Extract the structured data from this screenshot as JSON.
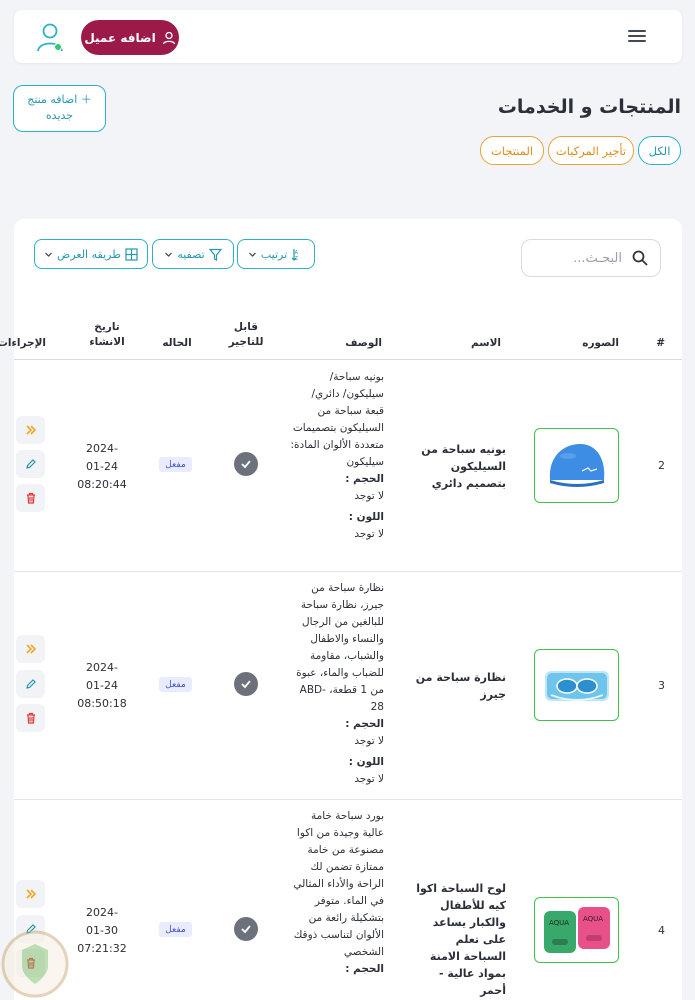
{
  "topbar": {
    "add_client_label": "اضافه عميل",
    "icons": {
      "menu": "hamburger-menu-icon",
      "user": "user-avatar-icon",
      "client": "user-icon"
    }
  },
  "page": {
    "title": "المنتجات و الخدمات",
    "add_product_label": "اضافه منتج جديده",
    "tabs": [
      {
        "label": "الكل",
        "active": true
      },
      {
        "label": "تأجير المركبات",
        "active": false
      },
      {
        "label": "المنتجات",
        "active": false
      }
    ]
  },
  "toolbar": {
    "search_placeholder": "البحـث...",
    "sort_label": "ترتيب",
    "filter_label": "تصفيه",
    "view_label": "طريقه العرض"
  },
  "table": {
    "columns": {
      "num": "#",
      "image": "الصوره",
      "name": "الاسم",
      "description": "الوصف",
      "rentable": "قابل للتاجير",
      "status": "الحاله",
      "created": "تاريخ الانشاء",
      "actions": "الإجراءات"
    },
    "rows": [
      {
        "num": "2",
        "name": "بونيه سباحة من السيليكون بتصميم دائري",
        "desc": "بونيه سباحة/ سيليكون/ دائري/ قبعة سباحة من السيليكون بتصميمات متعددة الألوان المادة: سيليكون",
        "size_label": "الحجم :",
        "size_value": "لا توجد",
        "color_label": "اللون :",
        "color_value": "لا توجد",
        "status": "مفعل",
        "date_line1": "2024-",
        "date_line2": "01-24",
        "date_line3": "08:20:44"
      },
      {
        "num": "3",
        "name": "نظارة سباحة من جيرز",
        "desc": "نظارة سباحة من جيرز، نظارة سباحة للبالغين من الرجال والنساء والاطفال والشباب، مقاومة للضباب والماء، عبوة من 1 قطعة، ABD-28",
        "size_label": "الحجم :",
        "size_value": "لا توجد",
        "color_label": "اللون :",
        "color_value": "لا توجد",
        "status": "مفعل",
        "date_line1": "2024-",
        "date_line2": "01-24",
        "date_line3": "08:50:18"
      },
      {
        "num": "4",
        "name": "لوح السباحة اكوا كيه للأطفال والكبار يساعد على تعلم السباحة الامنة بمواد عالية - أحمر",
        "desc": "بورد سباحة خامة عالية وجيدة من اكوا مصنوعة من خامة ممتازة تضمن لك الراحة والأداء المثالي في الماء. متوفر بتشكيلة رائعة من الألوان لتناسب ذوقك الشخصي",
        "size_label": "الحجم :",
        "status": "مفعل",
        "date_line1": "2024-",
        "date_line2": "01-30",
        "date_line3": "07:21:32"
      }
    ]
  },
  "colors": {
    "brand": "#9c1a4a",
    "accent_teal": "#2bb1c9",
    "accent_orange": "#e8a33a",
    "delete_red": "#e53935",
    "forward_orange": "#f5a623",
    "image_border_green": "#3ec24a"
  }
}
